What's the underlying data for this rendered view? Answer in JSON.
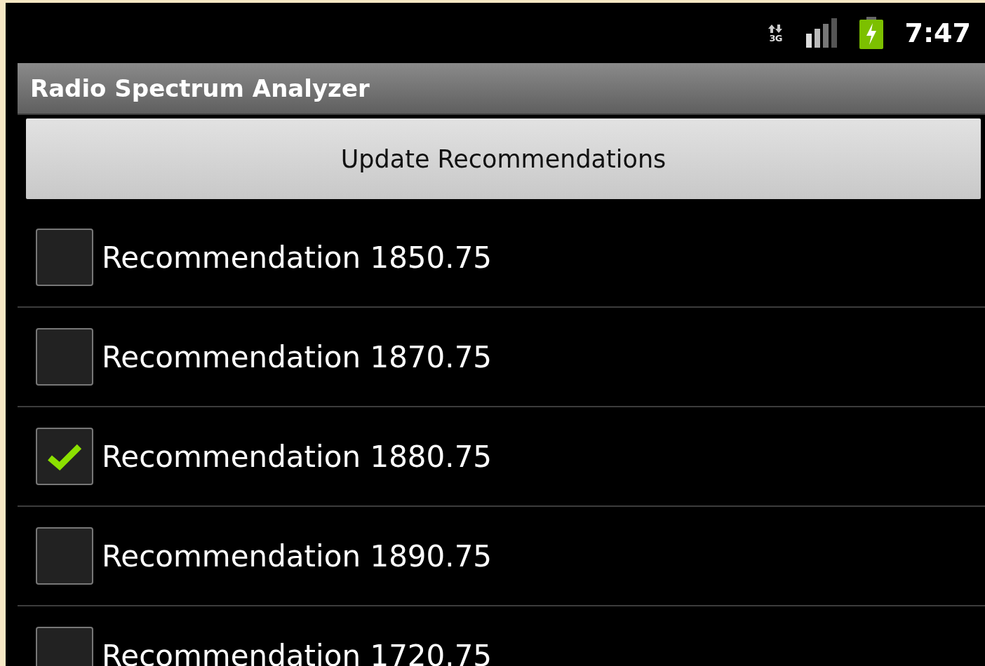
{
  "status_bar": {
    "network_type": "3G",
    "time": "7:47"
  },
  "title_bar": {
    "title": "Radio Spectrum Analyzer"
  },
  "update_button": {
    "label": "Update Recommendations"
  },
  "recommendations": [
    {
      "label": "Recommendation 1850.75",
      "checked": false
    },
    {
      "label": "Recommendation 1870.75",
      "checked": false
    },
    {
      "label": "Recommendation 1880.75",
      "checked": true
    },
    {
      "label": "Recommendation 1890.75",
      "checked": false
    },
    {
      "label": "Recommendation 1720.75",
      "checked": false
    }
  ]
}
